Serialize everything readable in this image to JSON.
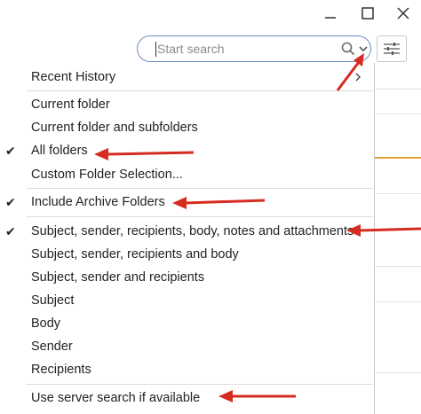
{
  "window": {
    "minimize_icon": "minimize-icon",
    "maximize_icon": "maximize-icon",
    "close_icon": "close-icon"
  },
  "search": {
    "placeholder": "Start search",
    "value": "",
    "search_icon": "search-icon",
    "dropdown_icon": "chevron-down-icon",
    "filter_icon": "filter-sliders-icon"
  },
  "menu": {
    "recent_history": "Recent History",
    "scope": [
      {
        "label": "Current folder",
        "checked": false
      },
      {
        "label": "Current folder and subfolders",
        "checked": false
      },
      {
        "label": "All folders",
        "checked": true
      },
      {
        "label": "Custom Folder Selection...",
        "checked": false
      }
    ],
    "archive": {
      "label": "Include Archive Folders",
      "checked": true
    },
    "fields": [
      {
        "label": "Subject, sender, recipients, body, notes and attachments",
        "checked": true
      },
      {
        "label": "Subject, sender, recipients and body",
        "checked": false
      },
      {
        "label": "Subject, sender and recipients",
        "checked": false
      },
      {
        "label": "Subject",
        "checked": false
      },
      {
        "label": "Body",
        "checked": false
      },
      {
        "label": "Sender",
        "checked": false
      },
      {
        "label": "Recipients",
        "checked": false
      }
    ],
    "server_search": {
      "label": "Use server search if available",
      "checked": false
    },
    "check_glyph": "✔"
  },
  "colors": {
    "annotation_red": "#d62b1f",
    "search_border": "#6c8ebf",
    "accent_orange": "#e8a33a"
  }
}
